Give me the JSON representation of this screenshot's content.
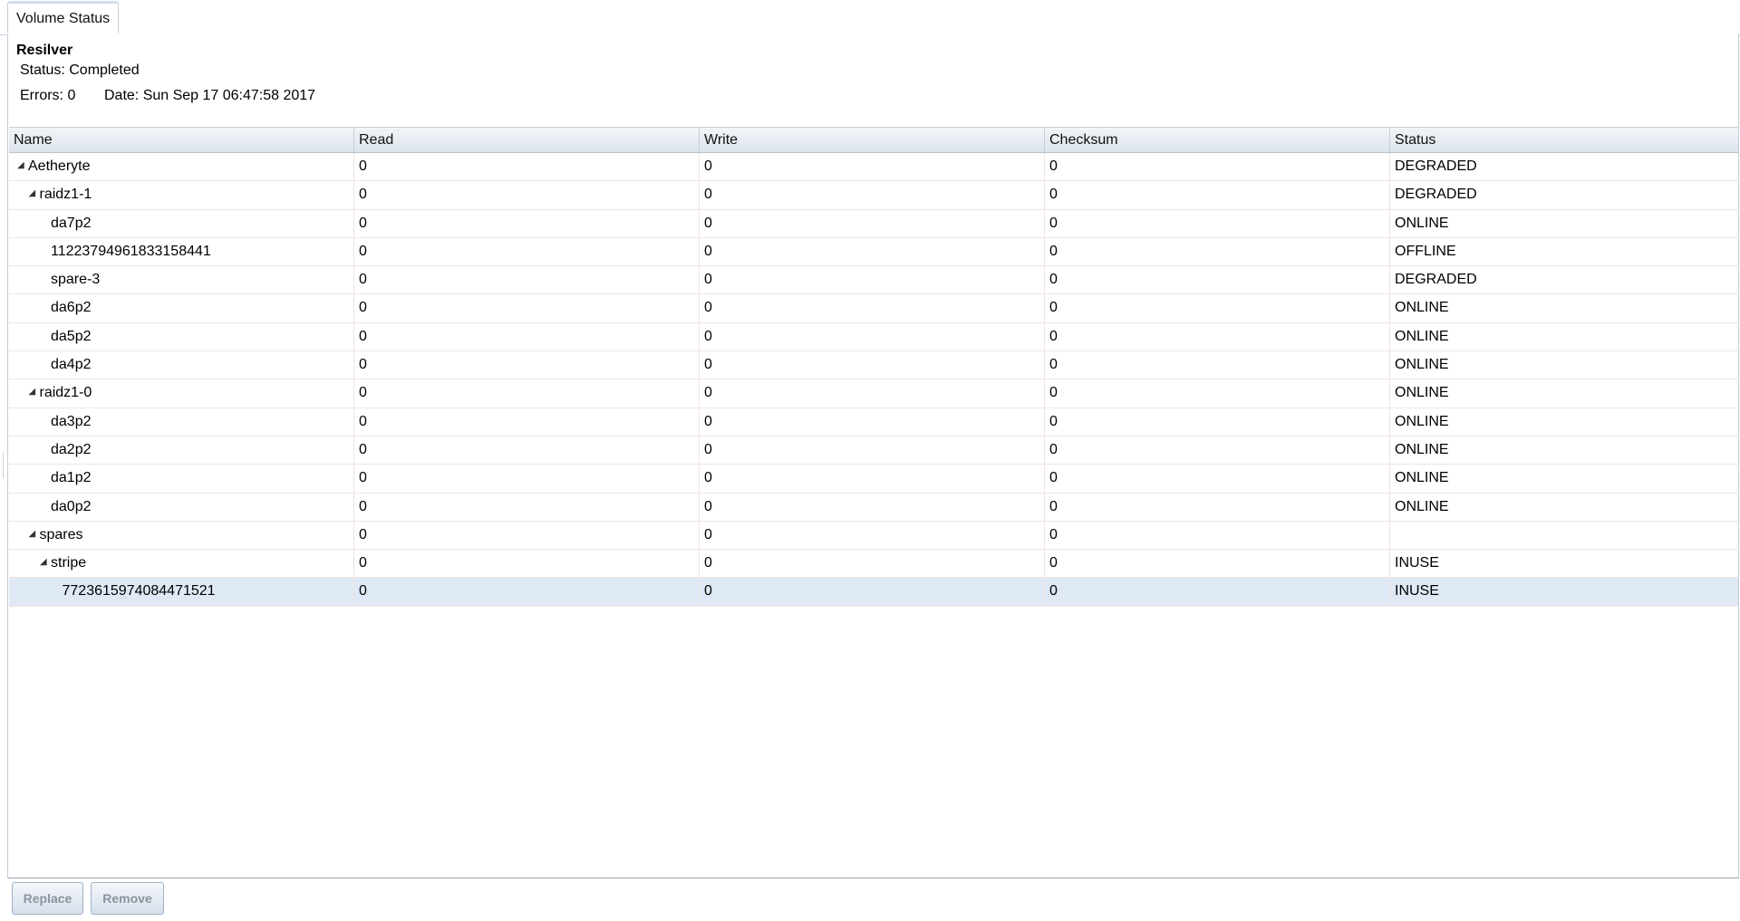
{
  "tabs": [
    {
      "label": "Volume Status",
      "active": true
    }
  ],
  "resilver": {
    "title": "Resilver",
    "status": "Status: Completed",
    "errors": "Errors: 0",
    "date": "Date: Sun Sep 17 06:47:58 2017"
  },
  "table": {
    "columns": [
      "Name",
      "Read",
      "Write",
      "Checksum",
      "Status"
    ],
    "rows": [
      {
        "name": "Aetheryte",
        "level": 0,
        "expandable": true,
        "expanded": true,
        "read": "0",
        "write": "0",
        "checksum": "0",
        "status": "DEGRADED",
        "selected": false
      },
      {
        "name": "raidz1-1",
        "level": 1,
        "expandable": true,
        "expanded": true,
        "read": "0",
        "write": "0",
        "checksum": "0",
        "status": "DEGRADED",
        "selected": false
      },
      {
        "name": "da7p2",
        "level": 2,
        "expandable": false,
        "read": "0",
        "write": "0",
        "checksum": "0",
        "status": "ONLINE",
        "selected": false
      },
      {
        "name": "11223794961833158441",
        "level": 2,
        "expandable": false,
        "read": "0",
        "write": "0",
        "checksum": "0",
        "status": "OFFLINE",
        "selected": false
      },
      {
        "name": "spare-3",
        "level": 2,
        "expandable": false,
        "read": "0",
        "write": "0",
        "checksum": "0",
        "status": "DEGRADED",
        "selected": false
      },
      {
        "name": "da6p2",
        "level": 2,
        "expandable": false,
        "read": "0",
        "write": "0",
        "checksum": "0",
        "status": "ONLINE",
        "selected": false
      },
      {
        "name": "da5p2",
        "level": 2,
        "expandable": false,
        "read": "0",
        "write": "0",
        "checksum": "0",
        "status": "ONLINE",
        "selected": false
      },
      {
        "name": "da4p2",
        "level": 2,
        "expandable": false,
        "read": "0",
        "write": "0",
        "checksum": "0",
        "status": "ONLINE",
        "selected": false
      },
      {
        "name": "raidz1-0",
        "level": 1,
        "expandable": true,
        "expanded": true,
        "read": "0",
        "write": "0",
        "checksum": "0",
        "status": "ONLINE",
        "selected": false
      },
      {
        "name": "da3p2",
        "level": 2,
        "expandable": false,
        "read": "0",
        "write": "0",
        "checksum": "0",
        "status": "ONLINE",
        "selected": false
      },
      {
        "name": "da2p2",
        "level": 2,
        "expandable": false,
        "read": "0",
        "write": "0",
        "checksum": "0",
        "status": "ONLINE",
        "selected": false
      },
      {
        "name": "da1p2",
        "level": 2,
        "expandable": false,
        "read": "0",
        "write": "0",
        "checksum": "0",
        "status": "ONLINE",
        "selected": false
      },
      {
        "name": "da0p2",
        "level": 2,
        "expandable": false,
        "read": "0",
        "write": "0",
        "checksum": "0",
        "status": "ONLINE",
        "selected": false
      },
      {
        "name": "spares",
        "level": 1,
        "expandable": true,
        "expanded": true,
        "read": "0",
        "write": "0",
        "checksum": "0",
        "status": "",
        "selected": false
      },
      {
        "name": "stripe",
        "level": 2,
        "expandable": true,
        "expanded": true,
        "read": "0",
        "write": "0",
        "checksum": "0",
        "status": "INUSE",
        "selected": false
      },
      {
        "name": "7723615974084471521",
        "level": 3,
        "expandable": false,
        "read": "0",
        "write": "0",
        "checksum": "0",
        "status": "INUSE",
        "selected": true
      }
    ]
  },
  "buttons": {
    "replace": "Replace",
    "remove": "Remove"
  },
  "icons": {
    "expander": "triangle-expanded-icon"
  }
}
